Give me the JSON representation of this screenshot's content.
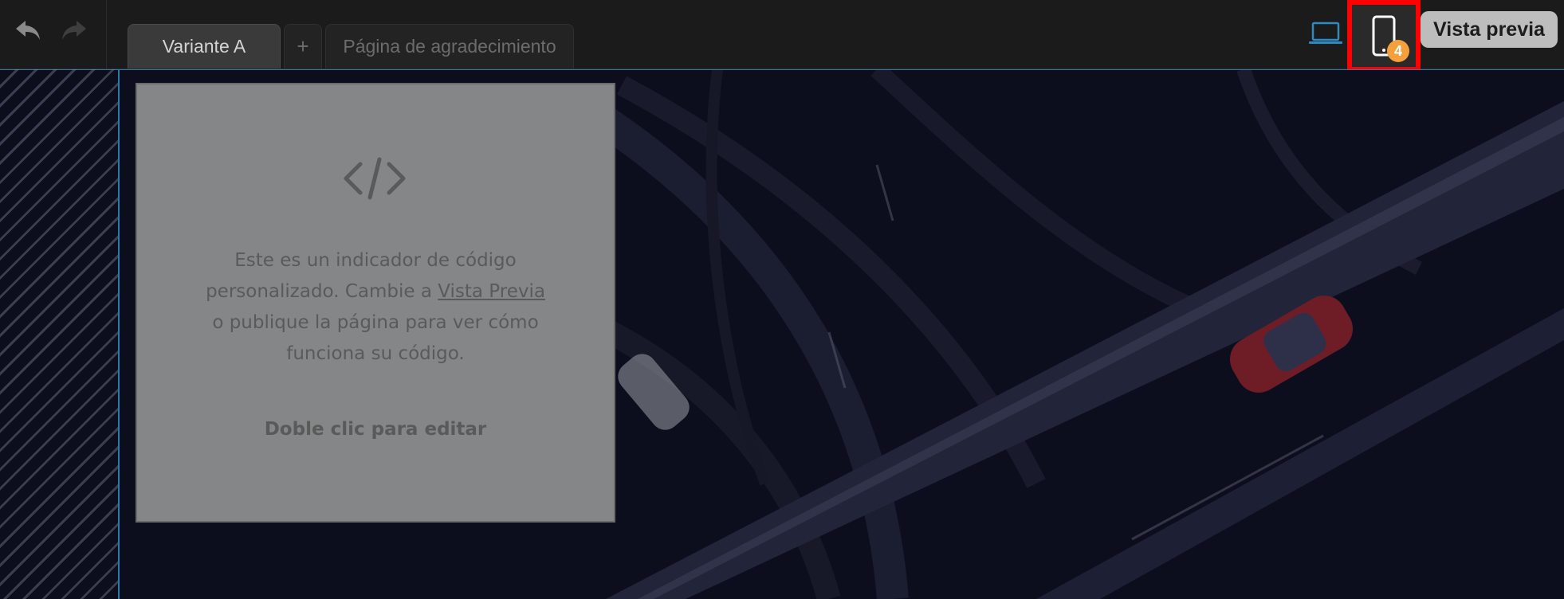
{
  "toolbar": {
    "undo_icon": "undo-arrow-icon",
    "redo_icon": "redo-arrow-icon",
    "tabs": [
      {
        "label": "Variante A",
        "active": true
      },
      {
        "label": "+",
        "active": false
      },
      {
        "label": "Página de agradecimiento",
        "active": false
      }
    ],
    "devices": {
      "desktop_icon": "laptop-icon",
      "mobile_icon": "mobile-phone-icon",
      "mobile_badge": "4",
      "selected": "mobile"
    },
    "preview_label": "Vista previa"
  },
  "code_block": {
    "icon": "code-brackets-icon",
    "line1": "Este es un indicador de código",
    "line2_prefix": "personalizado. Cambie a ",
    "line2_link": "Vista Previa",
    "line3": "o publique la página para ver cómo",
    "line4": "funciona su código.",
    "edit_hint": "Doble clic para editar"
  },
  "colors": {
    "highlight": "#ff0000",
    "badge": "#f5a03a",
    "accent": "#2c7aa8",
    "placeholder_bg": "#858687"
  }
}
